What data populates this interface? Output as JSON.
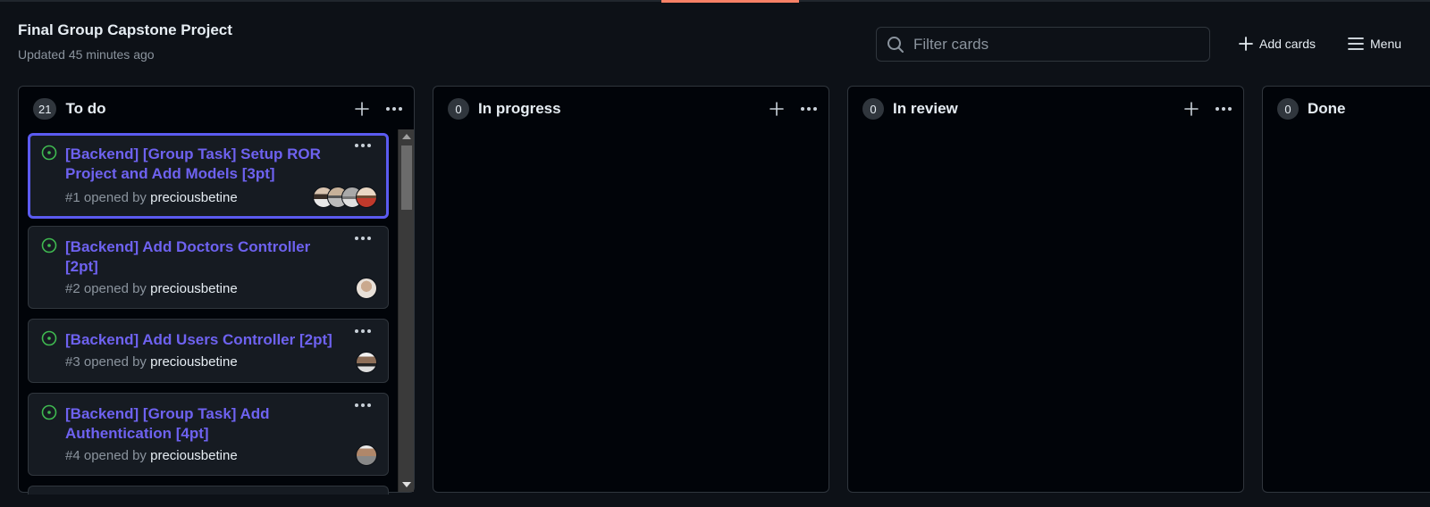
{
  "project": {
    "title": "Final Group Capstone Project",
    "updated": "Updated 45 minutes ago"
  },
  "toolbar": {
    "filter_placeholder": "Filter cards",
    "add_cards_label": "Add cards",
    "menu_label": "Menu"
  },
  "columns": [
    {
      "count": "21",
      "title": "To do",
      "cards": [
        {
          "title": "[Backend] [Group Task] Setup ROR Project and Add Models [3pt]",
          "number": "#1",
          "opened_by": "opened by",
          "author": "preciousbetine",
          "avatars": 4,
          "selected": true
        },
        {
          "title": "[Backend] Add Doctors Controller [2pt]",
          "number": "#2",
          "opened_by": "opened by",
          "author": "preciousbetine",
          "avatars": 1
        },
        {
          "title": "[Backend] Add Users Controller [2pt]",
          "number": "#3",
          "opened_by": "opened by",
          "author": "preciousbetine",
          "avatars": 1
        },
        {
          "title": "[Backend] [Group Task] Add Authentication [4pt]",
          "number": "#4",
          "opened_by": "opened by",
          "author": "preciousbetine",
          "avatars": 1
        }
      ]
    },
    {
      "count": "0",
      "title": "In progress",
      "cards": []
    },
    {
      "count": "0",
      "title": "In review",
      "cards": []
    },
    {
      "count": "0",
      "title": "Done",
      "cards": []
    }
  ],
  "colors": {
    "background": "#0d1117",
    "column_bg": "#010409",
    "card_bg": "#161b22",
    "accent_link": "#6e62f0",
    "selected_border": "#5b5bf0",
    "open_status": "#3fb950",
    "tab_accent": "#f78166"
  },
  "icons": {
    "search": "search-icon",
    "plus": "plus-icon",
    "menu": "hamburger-icon",
    "more": "kebab-horizontal-icon",
    "issue_open": "issue-opened-icon"
  }
}
